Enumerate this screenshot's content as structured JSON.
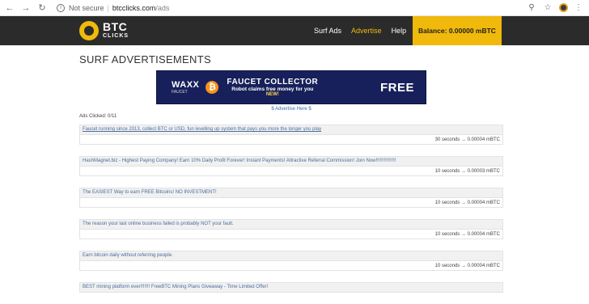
{
  "browser": {
    "back_icon": "back-arrow-icon",
    "forward_icon": "forward-arrow-icon",
    "reload_icon": "reload-icon",
    "security_label": "Not secure",
    "host": "btcclicks.com",
    "path": "/ads"
  },
  "header": {
    "logo_line1": "BTC",
    "logo_line2": "CLICKS",
    "nav": [
      {
        "label": "Surf Ads"
      },
      {
        "label": "Advertise"
      },
      {
        "label": "Help"
      }
    ],
    "balance": "Balance: 0.00000 mBTC",
    "accent_color": "#f0b90b"
  },
  "main": {
    "title": "SURF ADVERTISEMENTS",
    "banner": {
      "brand": "WAXX",
      "brand_sub": "FAUCET",
      "headline": "FAUCET COLLECTOR",
      "subline": "Robot claims free money for you",
      "badge": "NEW!",
      "cta": "FREE"
    },
    "advertise_link": "$ Advertise Here $",
    "ads_clicked": "Ads Clicked: 0/11",
    "ads": [
      {
        "title": "Faucet running since 2013, collect BTC or USD, fun levelling up system that pays you more the longer you play",
        "meta": "30 seconds → 0.00004 mBTC"
      },
      {
        "title": "HashMagnet.biz - Highest Paying Company! Earn 10% Daily Profit Forever! Instant Payments! Attractive Referral Commission! Join Now!!!!!!!!!!!!!!!",
        "meta": "10 seconds → 0.00003 mBTC"
      },
      {
        "title": "The EASIEST Way to earn FREE Bitcoins! NO INVESTMENT!",
        "meta": "10 seconds → 0.00004 mBTC"
      },
      {
        "title": "The reason your last online business failed is probably NOT your fault.",
        "meta": "10 seconds → 0.00004 mBTC"
      },
      {
        "title": "Earn bitcoin daily without referring people.",
        "meta": "10 seconds → 0.00004 mBTC"
      },
      {
        "title": "BEST mining platform ever!!!!!!! FreeBTC Mining Plans Giveaway - Time Limited Offer!",
        "meta": ""
      }
    ]
  }
}
